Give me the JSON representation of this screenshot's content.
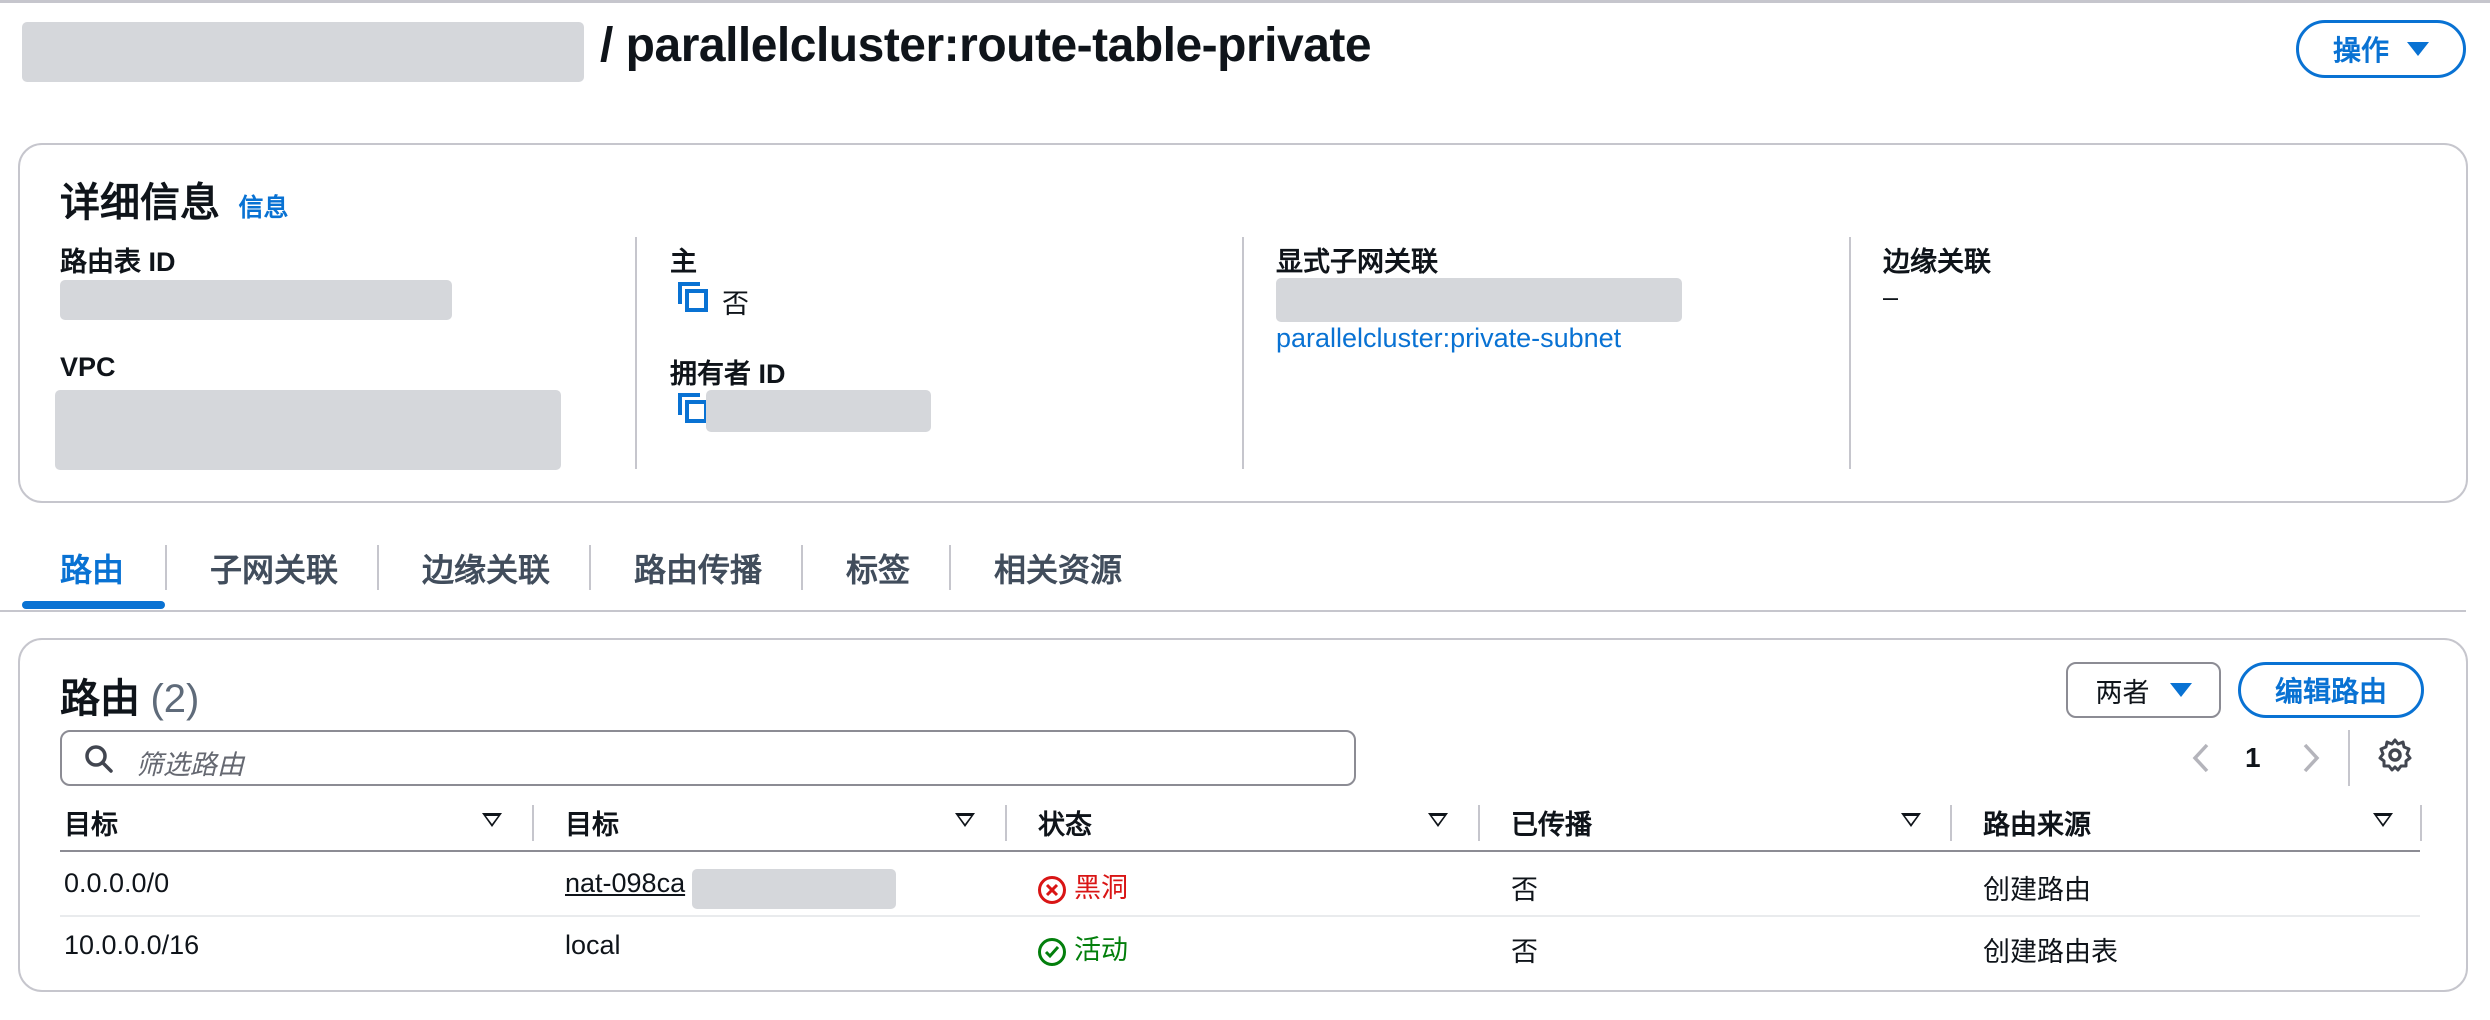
{
  "header": {
    "title": "/ parallelcluster:route-table-private",
    "actions_label": "操作"
  },
  "details": {
    "heading": "详细信息",
    "info_label": "信息",
    "route_table_id_label": "路由表 ID",
    "vpc_label": "VPC",
    "main_label": "主",
    "main_value": "否",
    "owner_id_label": "拥有者 ID",
    "explicit_subnet_label": "显式子网关联",
    "explicit_subnet_link": "parallelcluster:private-subnet",
    "edge_assoc_label": "边缘关联",
    "edge_assoc_value": "–"
  },
  "tabs": [
    {
      "label": "路由",
      "active": true
    },
    {
      "label": "子网关联"
    },
    {
      "label": "边缘关联"
    },
    {
      "label": "路由传播"
    },
    {
      "label": "标签"
    },
    {
      "label": "相关资源"
    }
  ],
  "routes": {
    "heading": "路由",
    "count": "(2)",
    "filter_select": "两者",
    "edit_button": "编辑路由",
    "search_placeholder": "筛选路由",
    "page": "1",
    "columns": [
      "目标",
      "目标",
      "状态",
      "已传播",
      "路由来源"
    ],
    "rows": [
      {
        "destination": "0.0.0.0/0",
        "target": "nat-098ca",
        "status": "黑洞",
        "propagated": "否",
        "origin": "创建路由"
      },
      {
        "destination": "10.0.0.0/16",
        "target": "local",
        "status": "活动",
        "propagated": "否",
        "origin": "创建路由表"
      }
    ]
  },
  "colors": {
    "accent": "#0972d3",
    "error": "#d91515",
    "success": "#037f0c"
  }
}
